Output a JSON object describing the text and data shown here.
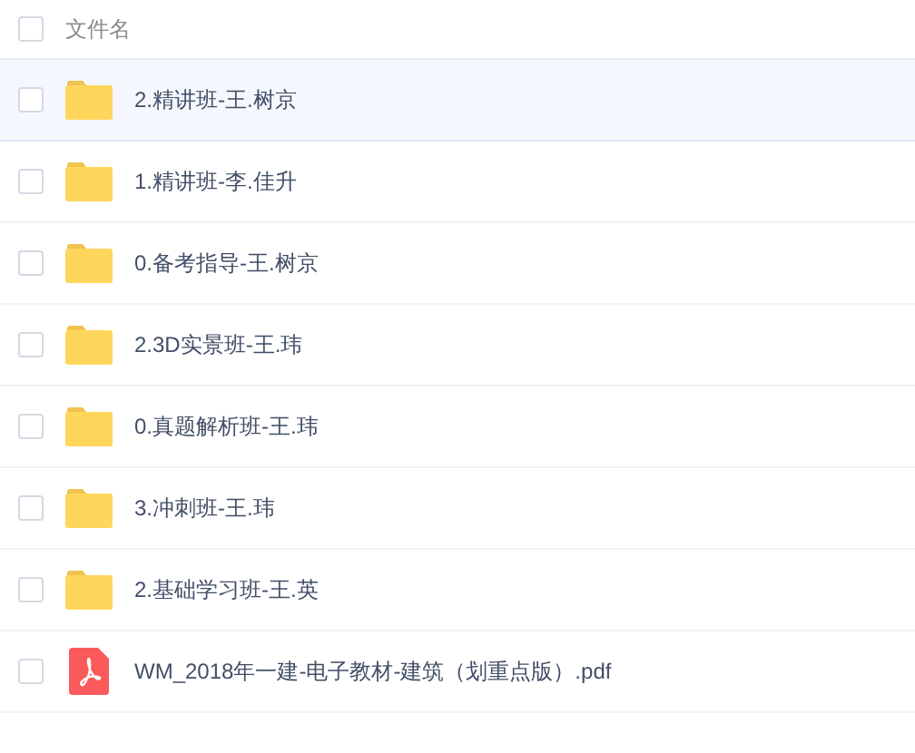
{
  "header": {
    "label": "文件名",
    "checked": false
  },
  "files": [
    {
      "kind": "folder",
      "name": "2.精讲班-王.树京",
      "selected": true,
      "checked": false
    },
    {
      "kind": "folder",
      "name": "1.精讲班-李.佳升",
      "selected": false,
      "checked": false
    },
    {
      "kind": "folder",
      "name": "0.备考指导-王.树京",
      "selected": false,
      "checked": false
    },
    {
      "kind": "folder",
      "name": "2.3D实景班-王.玮",
      "selected": false,
      "checked": false
    },
    {
      "kind": "folder",
      "name": "0.真题解析班-王.玮",
      "selected": false,
      "checked": false
    },
    {
      "kind": "folder",
      "name": "3.冲刺班-王.玮",
      "selected": false,
      "checked": false
    },
    {
      "kind": "folder",
      "name": "2.基础学习班-王.英",
      "selected": false,
      "checked": false
    },
    {
      "kind": "pdf",
      "name": "WM_2018年一建-电子教材-建筑（划重点版）.pdf",
      "selected": false,
      "checked": false
    }
  ]
}
